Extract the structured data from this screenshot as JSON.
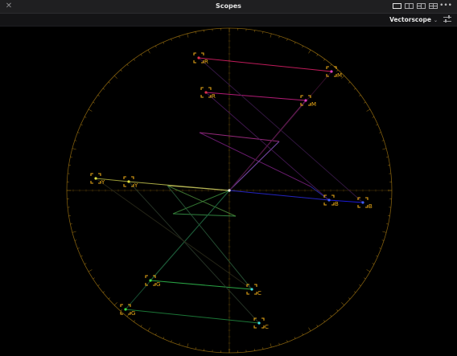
{
  "window": {
    "title": "Scopes",
    "close_icon": "close-icon",
    "more_icon": "more-icon"
  },
  "layouts": [
    {
      "name": "single-scope-layout-icon",
      "active": true
    },
    {
      "name": "dual-scope-layout-icon",
      "active": false
    },
    {
      "name": "triple-scope-layout-icon",
      "active": false
    },
    {
      "name": "quad-scope-layout-icon",
      "active": false
    }
  ],
  "toolbar": {
    "scope_type": "Vectorscope",
    "settings_icon": "scope-settings-icon"
  },
  "colors": {
    "graticule": "#e8a817",
    "background": "#000000"
  },
  "targets": [
    {
      "id": "r-75",
      "label": "R"
    },
    {
      "id": "m-75",
      "label": "M"
    },
    {
      "id": "b-75",
      "label": "B"
    },
    {
      "id": "c-75",
      "label": "C"
    },
    {
      "id": "g-75",
      "label": "G"
    },
    {
      "id": "y-75",
      "label": "Y"
    },
    {
      "id": "r-100",
      "label": "R"
    },
    {
      "id": "m-100",
      "label": "M"
    },
    {
      "id": "b-100",
      "label": "B"
    },
    {
      "id": "c-100",
      "label": "C"
    },
    {
      "id": "g-100",
      "label": "G"
    },
    {
      "id": "y-100",
      "label": "Y"
    }
  ]
}
